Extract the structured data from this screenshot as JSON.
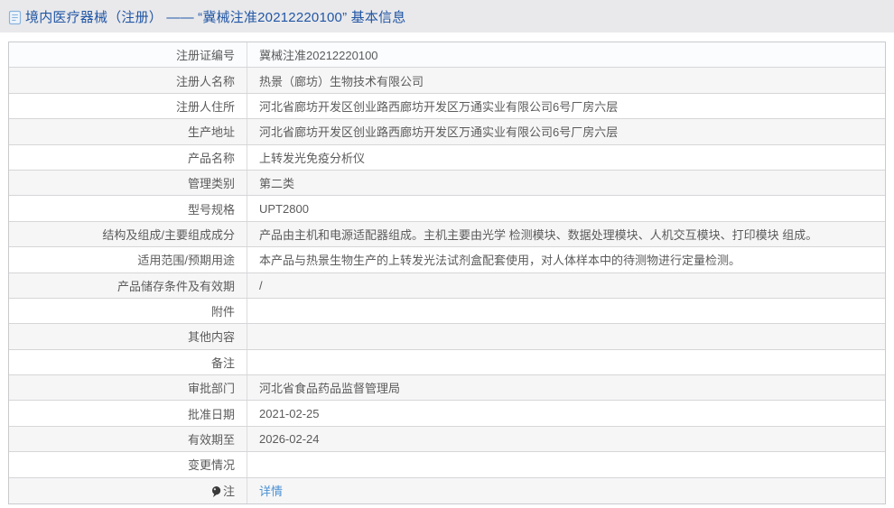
{
  "header": {
    "title": "境内医疗器械（注册） —— “冀械注准20212220100” 基本信息"
  },
  "colors": {
    "header_bg": "#e9e9eb",
    "title_blue": "#2156a5",
    "link_blue": "#4a90d2",
    "row_alt_bg": "#f6f6f7",
    "first_row_bg": "#fafcfe",
    "border": "#c9cacd",
    "text": "#5b5b5b"
  },
  "table": {
    "rows": [
      {
        "label": "注册证编号",
        "value": "冀械注准20212220100"
      },
      {
        "label": "注册人名称",
        "value": "热景（廊坊）生物技术有限公司"
      },
      {
        "label": "注册人住所",
        "value": "河北省廊坊开发区创业路西廊坊开发区万通实业有限公司6号厂房六层"
      },
      {
        "label": "生产地址",
        "value": "河北省廊坊开发区创业路西廊坊开发区万通实业有限公司6号厂房六层"
      },
      {
        "label": "产品名称",
        "value": "上转发光免疫分析仪"
      },
      {
        "label": "管理类别",
        "value": "第二类"
      },
      {
        "label": "型号规格",
        "value": "UPT2800"
      },
      {
        "label": "结构及组成/主要组成成分",
        "value": "产品由主机和电源适配器组成。主机主要由光学 检测模块、数据处理模块、人机交互模块、打印模块 组成。"
      },
      {
        "label": "适用范围/预期用途",
        "value": "本产品与热景生物生产的上转发光法试剂盒配套使用，对人体样本中的待测物进行定量检测。"
      },
      {
        "label": "产品储存条件及有效期",
        "value": "/"
      },
      {
        "label": "附件",
        "value": ""
      },
      {
        "label": "其他内容",
        "value": ""
      },
      {
        "label": "备注",
        "value": ""
      },
      {
        "label": "审批部门",
        "value": "河北省食品药品监督管理局"
      },
      {
        "label": "批准日期",
        "value": "2021-02-25"
      },
      {
        "label": "有效期至",
        "value": "2026-02-24"
      },
      {
        "label": "变更情况",
        "value": ""
      },
      {
        "label": "注",
        "value": ""
      }
    ],
    "note_link_label": "详情"
  }
}
